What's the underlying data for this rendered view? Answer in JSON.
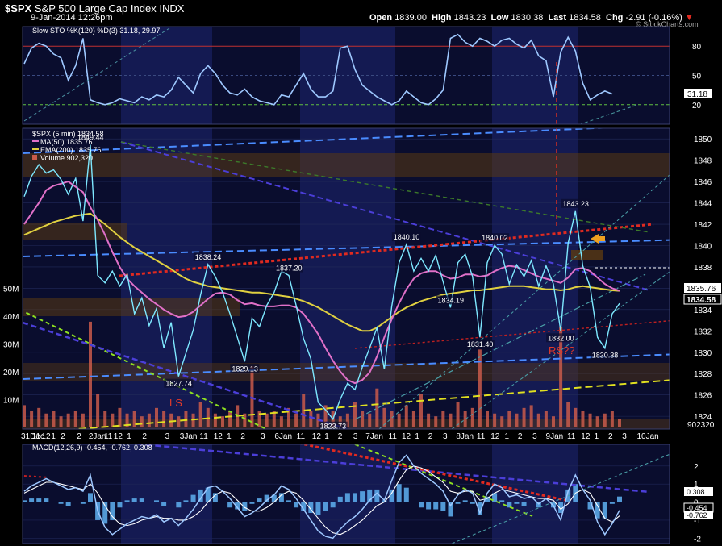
{
  "header": {
    "symbol": "$SPX",
    "name": "S&P 500 Large Cap Index",
    "exchange": "INDX",
    "datetime": "9-Jan-2014 12:26pm",
    "open_label": "Open",
    "open": "1839.00",
    "high_label": "High",
    "high": "1843.23",
    "low_label": "Low",
    "low": "1830.38",
    "last_label": "Last",
    "last": "1834.58",
    "chg_label": "Chg",
    "chg": "-2.91 (-0.16%)",
    "watermark": "© StockCharts.com"
  },
  "colors": {
    "background": "#000000",
    "panel": "#0a0d2e",
    "shade": "#13184a",
    "price": "#7ee8ff",
    "ma50": "#e070c8",
    "ema200": "#e0d040",
    "volume": "#c95a4a",
    "red_trend": "#e02a20",
    "blue_trend": "#4a8cff",
    "sto_line": "#9ec8ff"
  },
  "chart_data": [
    {
      "type": "line",
      "title": "Slow STO %K(120) %D(3) 31.18, 29.97",
      "ylim": [
        0,
        100
      ],
      "yticks": [
        20,
        50,
        80
      ],
      "reference_lines": [
        20,
        80
      ],
      "last_value_label": "31.18",
      "series": [
        {
          "name": "%K",
          "values": [
            62,
            78,
            83,
            80,
            72,
            68,
            45,
            60,
            88,
            25,
            22,
            20,
            22,
            26,
            24,
            22,
            28,
            25,
            30,
            28,
            35,
            48,
            40,
            32,
            52,
            60,
            52,
            40,
            32,
            30,
            36,
            28,
            24,
            22,
            20,
            30,
            28,
            40,
            52,
            36,
            28,
            28,
            34,
            78,
            80,
            56,
            40,
            34,
            28,
            24,
            20,
            24,
            34,
            28,
            22,
            20,
            26,
            35,
            88,
            92,
            84,
            80,
            88,
            85,
            80,
            86,
            88,
            82,
            78,
            86,
            70,
            65,
            28,
            74,
            89,
            75,
            42,
            25,
            30,
            34,
            31
          ]
        }
      ]
    },
    {
      "type": "line",
      "title": "$SPX (5 min) 1834.58",
      "ylim": [
        1822.8,
        1851
      ],
      "yticks": [
        1824,
        1826,
        1828,
        1830,
        1832,
        1834,
        1836,
        1838,
        1840,
        1842,
        1844,
        1846,
        1848,
        1850
      ],
      "series": [
        {
          "name": "$SPX (5 min) 1834.58",
          "values": [
            1844.6,
            1846.5,
            1847.6,
            1846.8,
            1847.1,
            1846.2,
            1844.8,
            1846.3,
            1842.3,
            1849.44,
            1837.2,
            1836.5,
            1837.6,
            1836.2,
            1837.3,
            1833.6,
            1835.1,
            1832.5,
            1834.1,
            1830.4,
            1832.8,
            1827.74,
            1829.9,
            1832.1,
            1835.4,
            1838.24,
            1837.1,
            1835.6,
            1833.6,
            1831.4,
            1829.13,
            1833.2,
            1832.4,
            1834.4,
            1835.6,
            1837.6,
            1837.2,
            1834.4,
            1831.3,
            1829.4,
            1825.3,
            1824.6,
            1823.73,
            1825.6,
            1827.1,
            1826.5,
            1828.6,
            1830.4,
            1832.3,
            1828.4,
            1834.3,
            1838.4,
            1840.1,
            1837.6,
            1838.8,
            1837.6,
            1839.1,
            1836.6,
            1834.19,
            1838.4,
            1839.2,
            1837.1,
            1831.4,
            1838.4,
            1840.02,
            1839.2,
            1836.4,
            1838.2,
            1837.1,
            1838.6,
            1836.2,
            1838.1,
            1836.4,
            1832.0,
            1840.2,
            1843.23,
            1838.1,
            1836.1,
            1831.4,
            1830.38,
            1833.6,
            1834.58
          ]
        },
        {
          "name": "MA(50) 1835.76",
          "values": [
            1842,
            1843,
            1844,
            1845.2,
            1845.6,
            1845.8,
            1846,
            1845.5,
            1845,
            1843.6,
            1842.4,
            1841,
            1839.4,
            1838,
            1836.9,
            1836.2,
            1835.6,
            1835,
            1834.5,
            1834,
            1833.6,
            1833.3,
            1833.4,
            1833.8,
            1834.4,
            1835,
            1835.5,
            1835.6,
            1835.4,
            1834.9,
            1834.5,
            1834.6,
            1834.4,
            1834.3,
            1834.3,
            1834.4,
            1834.4,
            1834.2,
            1833.6,
            1832.7,
            1831.7,
            1830.4,
            1829.2,
            1828.2,
            1827.4,
            1827.1,
            1827.4,
            1828.1,
            1829.6,
            1831.4,
            1833.1,
            1834.6,
            1835.9,
            1836.9,
            1837.4,
            1837.6,
            1837.6,
            1837.2,
            1836.9,
            1837,
            1837.3,
            1837.3,
            1837.1,
            1837.2,
            1837.6,
            1837.9,
            1838.1,
            1838,
            1837.7,
            1837.4,
            1837.1,
            1836.9,
            1836.7,
            1836.5,
            1837,
            1837.8,
            1837.9,
            1837.6,
            1837,
            1836.4,
            1836,
            1835.76
          ]
        },
        {
          "name": "EMA(200) 1835.76",
          "values": [
            1841,
            1841.3,
            1841.6,
            1841.9,
            1842.2,
            1842.4,
            1842.6,
            1842.8,
            1842.9,
            1843,
            1842.5,
            1842,
            1841.4,
            1840.8,
            1840.3,
            1839.8,
            1839.4,
            1839,
            1838.6,
            1838.2,
            1837.8,
            1837.3,
            1836.9,
            1836.6,
            1836.4,
            1836.2,
            1836.1,
            1836,
            1835.9,
            1835.8,
            1835.7,
            1835.6,
            1835.6,
            1835.5,
            1835.4,
            1835.3,
            1835.2,
            1835,
            1834.8,
            1834.5,
            1834.2,
            1833.8,
            1833.4,
            1833,
            1832.6,
            1832.3,
            1832,
            1832,
            1832.3,
            1832.8,
            1833.3,
            1833.8,
            1834.2,
            1834.5,
            1834.8,
            1835,
            1835.2,
            1835.4,
            1835.5,
            1835.6,
            1835.7,
            1835.8,
            1835.8,
            1835.9,
            1836,
            1836.1,
            1836.2,
            1836.2,
            1836.2,
            1836.1,
            1836,
            1835.9,
            1835.9,
            1835.8,
            1835.9,
            1836.1,
            1836.2,
            1836.1,
            1836,
            1835.9,
            1835.8,
            1835.76
          ]
        }
      ],
      "price_annotations": [
        {
          "label": "1849.44",
          "idx": 9,
          "value": 1849.44
        },
        {
          "label": "1827.74",
          "idx": 21,
          "value": 1827.74
        },
        {
          "label": "1838.24",
          "idx": 25,
          "value": 1838.24
        },
        {
          "label": "1829.13",
          "idx": 30,
          "value": 1829.13
        },
        {
          "label": "1837.20",
          "idx": 36,
          "value": 1837.2
        },
        {
          "label": "1823.73",
          "idx": 42,
          "value": 1823.73
        },
        {
          "label": "1840.10",
          "idx": 52,
          "value": 1840.1
        },
        {
          "label": "1834.19",
          "idx": 58,
          "value": 1834.19
        },
        {
          "label": "1831.40",
          "idx": 62,
          "value": 1831.4
        },
        {
          "label": "1840.02",
          "idx": 64,
          "value": 1840.02
        },
        {
          "label": "1832.00",
          "idx": 73,
          "value": 1832.0
        },
        {
          "label": "1843.23",
          "idx": 75,
          "value": 1843.23
        },
        {
          "label": "1830.38",
          "idx": 79,
          "value": 1830.38
        }
      ],
      "text_annotations": [
        {
          "text": "LS",
          "color": "#e23a2a"
        },
        {
          "text": "RS??",
          "color": "#e23a2a"
        }
      ],
      "right_labels": [
        {
          "text": "1835.76",
          "value": 1835.76
        },
        {
          "text": "1834.58",
          "value": 1834.58
        }
      ]
    },
    {
      "type": "bar",
      "title": "Volume 902,320",
      "yticks_labels": [
        "10M",
        "20M",
        "30M",
        "40M",
        "50M"
      ],
      "yticks_values": [
        10,
        20,
        30,
        40,
        50
      ],
      "last_value_label": "902320",
      "values": [
        8,
        6,
        7,
        5,
        6,
        4,
        5,
        6,
        5,
        38,
        12,
        6,
        5,
        7,
        5,
        6,
        4,
        5,
        7,
        6,
        5,
        4,
        6,
        5,
        9,
        7,
        5,
        4,
        6,
        8,
        5,
        22,
        6,
        5,
        6,
        4,
        7,
        5,
        12,
        6,
        5,
        8,
        6,
        4,
        5,
        9,
        6,
        5,
        14,
        7,
        6,
        5,
        8,
        6,
        12,
        5,
        4,
        6,
        5,
        9,
        6,
        7,
        28,
        6,
        5,
        4,
        6,
        5,
        7,
        8,
        5,
        6,
        4,
        36,
        9,
        7,
        6,
        5,
        4,
        5,
        6,
        3
      ]
    },
    {
      "type": "line",
      "title": "MACD(12,26,9) -0.454, -0.762, 0.308",
      "ylim": [
        -2.3,
        3.2
      ],
      "yticks": [
        -2,
        -1,
        0,
        1,
        2
      ],
      "right_labels": [
        "0.308",
        "-0.454",
        "-0.762"
      ],
      "series": [
        {
          "name": "MACD",
          "values": [
            0.6,
            0.9,
            1.1,
            1.3,
            1.1,
            0.9,
            0.7,
            0.8,
            0.6,
            1.5,
            -0.5,
            -1.4,
            -1.8,
            -1.5,
            -1.2,
            -1.0,
            -0.8,
            -0.9,
            -0.7,
            -1.1,
            -0.9,
            -1.3,
            -0.9,
            -0.4,
            0.2,
            0.8,
            0.9,
            0.6,
            0.2,
            -0.3,
            -0.8,
            -0.6,
            -0.3,
            0.1,
            0.4,
            0.9,
            0.7,
            0.2,
            -0.4,
            -1.0,
            -1.6,
            -1.9,
            -2.0,
            -1.5,
            -1.1,
            -0.8,
            -0.4,
            0.1,
            0.5,
            0.1,
            1.2,
            2.2,
            2.6,
            2.0,
            1.6,
            1.3,
            1.0,
            0.6,
            -0.2,
            0.4,
            0.7,
            0.5,
            -0.6,
            0.5,
            1.0,
            0.8,
            0.3,
            0.4,
            0.2,
            0.3,
            -0.1,
            0.2,
            -0.2,
            -1.0,
            0.6,
            1.5,
            0.7,
            0.1,
            -1.1,
            -1.8,
            -1.2,
            -0.454
          ]
        },
        {
          "name": "Signal",
          "values": [
            0.5,
            0.7,
            0.9,
            1.1,
            1.1,
            1.0,
            0.9,
            0.8,
            0.7,
            1.0,
            0.5,
            -0.2,
            -0.8,
            -1.2,
            -1.3,
            -1.2,
            -1.0,
            -0.9,
            -0.8,
            -0.9,
            -0.9,
            -1.0,
            -1.0,
            -0.8,
            -0.5,
            0.0,
            0.4,
            0.6,
            0.5,
            0.1,
            -0.3,
            -0.5,
            -0.5,
            -0.3,
            0.0,
            0.4,
            0.6,
            0.5,
            0.1,
            -0.4,
            -0.9,
            -1.4,
            -1.7,
            -1.8,
            -1.6,
            -1.3,
            -1.0,
            -0.6,
            -0.2,
            0.0,
            0.5,
            1.2,
            1.8,
            2.0,
            1.9,
            1.7,
            1.4,
            1.1,
            0.6,
            0.5,
            0.6,
            0.6,
            0.1,
            0.2,
            0.5,
            0.7,
            0.6,
            0.5,
            0.4,
            0.3,
            0.2,
            0.2,
            0.1,
            -0.4,
            -0.1,
            0.5,
            0.7,
            0.5,
            -0.2,
            -0.9,
            -1.1,
            -0.762
          ]
        },
        {
          "name": "Histogram",
          "values": [
            0.1,
            0.2,
            0.2,
            0.2,
            0.0,
            -0.1,
            -0.2,
            0.0,
            -0.1,
            0.5,
            -1.0,
            -1.2,
            -1.0,
            -0.3,
            0.1,
            0.2,
            0.2,
            0.0,
            0.1,
            -0.2,
            0.0,
            -0.3,
            0.1,
            0.4,
            0.7,
            0.8,
            0.5,
            0.0,
            -0.3,
            -0.4,
            -0.5,
            -0.1,
            0.2,
            0.4,
            0.4,
            0.5,
            0.1,
            -0.3,
            -0.5,
            -0.6,
            -0.7,
            -0.5,
            -0.3,
            0.3,
            0.5,
            0.5,
            0.6,
            0.7,
            0.7,
            0.1,
            0.7,
            1.0,
            0.8,
            0.0,
            -0.3,
            -0.4,
            -0.4,
            -0.5,
            -0.8,
            -0.1,
            0.1,
            -0.1,
            -0.7,
            0.3,
            0.5,
            0.1,
            -0.3,
            -0.1,
            -0.2,
            0.0,
            -0.3,
            0.0,
            -0.3,
            -0.6,
            0.7,
            1.0,
            0.0,
            -0.4,
            -0.9,
            -0.9,
            -0.1,
            0.308
          ]
        }
      ]
    }
  ],
  "x_axis": {
    "ticks": [
      {
        "idx": 0,
        "text": "31Dec"
      },
      {
        "idx": 1.5,
        "text": "11"
      },
      {
        "idx": 2.8,
        "text": "12"
      },
      {
        "idx": 4.1,
        "text": "1"
      },
      {
        "idx": 5.4,
        "text": "2"
      },
      {
        "idx": 7.6,
        "text": "2"
      },
      {
        "idx": 9.2,
        "text": "2Jan"
      },
      {
        "idx": 11.3,
        "text": "11"
      },
      {
        "idx": 12.6,
        "text": "12"
      },
      {
        "idx": 14.4,
        "text": "1"
      },
      {
        "idx": 16.5,
        "text": "2"
      },
      {
        "idx": 19.6,
        "text": "3"
      },
      {
        "idx": 21.6,
        "text": "3Jan"
      },
      {
        "idx": 24.3,
        "text": "11"
      },
      {
        "idx": 26.2,
        "text": "12"
      },
      {
        "idx": 28,
        "text": "1"
      },
      {
        "idx": 29.9,
        "text": "2"
      },
      {
        "idx": 32.6,
        "text": "3"
      },
      {
        "idx": 34.5,
        "text": "6Jan"
      },
      {
        "idx": 37.5,
        "text": "11"
      },
      {
        "idx": 39.6,
        "text": "12"
      },
      {
        "idx": 41.3,
        "text": "1"
      },
      {
        "idx": 43.1,
        "text": "2"
      },
      {
        "idx": 45.2,
        "text": "3"
      },
      {
        "idx": 46.9,
        "text": "7Jan"
      },
      {
        "idx": 50,
        "text": "11"
      },
      {
        "idx": 51.8,
        "text": "12"
      },
      {
        "idx": 53.6,
        "text": "1"
      },
      {
        "idx": 55.4,
        "text": "2"
      },
      {
        "idx": 57.4,
        "text": "3"
      },
      {
        "idx": 59.2,
        "text": "8Jan"
      },
      {
        "idx": 62,
        "text": "11"
      },
      {
        "idx": 63.9,
        "text": "12"
      },
      {
        "idx": 65.8,
        "text": "1"
      },
      {
        "idx": 67.6,
        "text": "2"
      },
      {
        "idx": 69.6,
        "text": "3"
      },
      {
        "idx": 71.4,
        "text": "9Jan"
      },
      {
        "idx": 74.3,
        "text": "11"
      },
      {
        "idx": 76.2,
        "text": "12"
      },
      {
        "idx": 78,
        "text": "1"
      },
      {
        "idx": 79.9,
        "text": "2"
      },
      {
        "idx": 81.8,
        "text": "3"
      },
      {
        "idx": 83.8,
        "text": "10Jan"
      }
    ]
  }
}
